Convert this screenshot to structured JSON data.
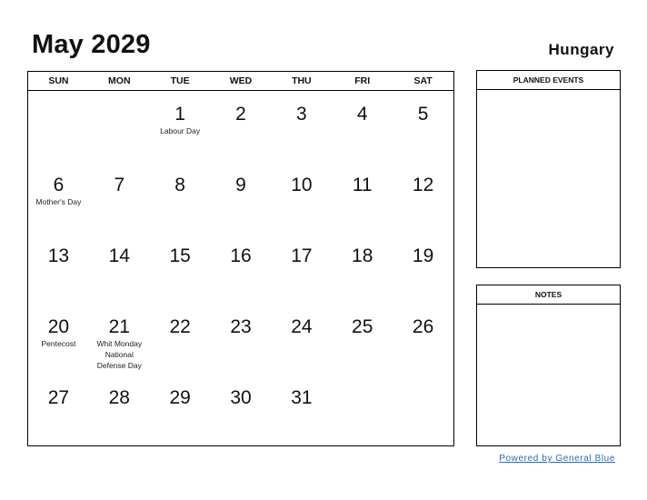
{
  "header": {
    "title": "May 2029",
    "country": "Hungary"
  },
  "calendar": {
    "weekdays": [
      "SUN",
      "MON",
      "TUE",
      "WED",
      "THU",
      "FRI",
      "SAT"
    ],
    "weeks": [
      [
        {
          "day": "",
          "holiday": ""
        },
        {
          "day": "",
          "holiday": ""
        },
        {
          "day": "1",
          "holiday": "Labour Day"
        },
        {
          "day": "2",
          "holiday": ""
        },
        {
          "day": "3",
          "holiday": ""
        },
        {
          "day": "4",
          "holiday": ""
        },
        {
          "day": "5",
          "holiday": ""
        }
      ],
      [
        {
          "day": "6",
          "holiday": "Mother's Day"
        },
        {
          "day": "7",
          "holiday": ""
        },
        {
          "day": "8",
          "holiday": ""
        },
        {
          "day": "9",
          "holiday": ""
        },
        {
          "day": "10",
          "holiday": ""
        },
        {
          "day": "11",
          "holiday": ""
        },
        {
          "day": "12",
          "holiday": ""
        }
      ],
      [
        {
          "day": "13",
          "holiday": ""
        },
        {
          "day": "14",
          "holiday": ""
        },
        {
          "day": "15",
          "holiday": ""
        },
        {
          "day": "16",
          "holiday": ""
        },
        {
          "day": "17",
          "holiday": ""
        },
        {
          "day": "18",
          "holiday": ""
        },
        {
          "day": "19",
          "holiday": ""
        }
      ],
      [
        {
          "day": "20",
          "holiday": "Pentecost"
        },
        {
          "day": "21",
          "holiday": "Whit Monday\nNational\nDefense Day"
        },
        {
          "day": "22",
          "holiday": ""
        },
        {
          "day": "23",
          "holiday": ""
        },
        {
          "day": "24",
          "holiday": ""
        },
        {
          "day": "25",
          "holiday": ""
        },
        {
          "day": "26",
          "holiday": ""
        }
      ],
      [
        {
          "day": "27",
          "holiday": ""
        },
        {
          "day": "28",
          "holiday": ""
        },
        {
          "day": "29",
          "holiday": ""
        },
        {
          "day": "30",
          "holiday": ""
        },
        {
          "day": "31",
          "holiday": ""
        },
        {
          "day": "",
          "holiday": ""
        },
        {
          "day": "",
          "holiday": ""
        }
      ]
    ]
  },
  "panels": {
    "planned_events_label": "PLANNED EVENTS",
    "notes_label": "NOTES"
  },
  "footer": {
    "link_text": "Powered by General Blue",
    "link_color": "#2a6ab5"
  }
}
